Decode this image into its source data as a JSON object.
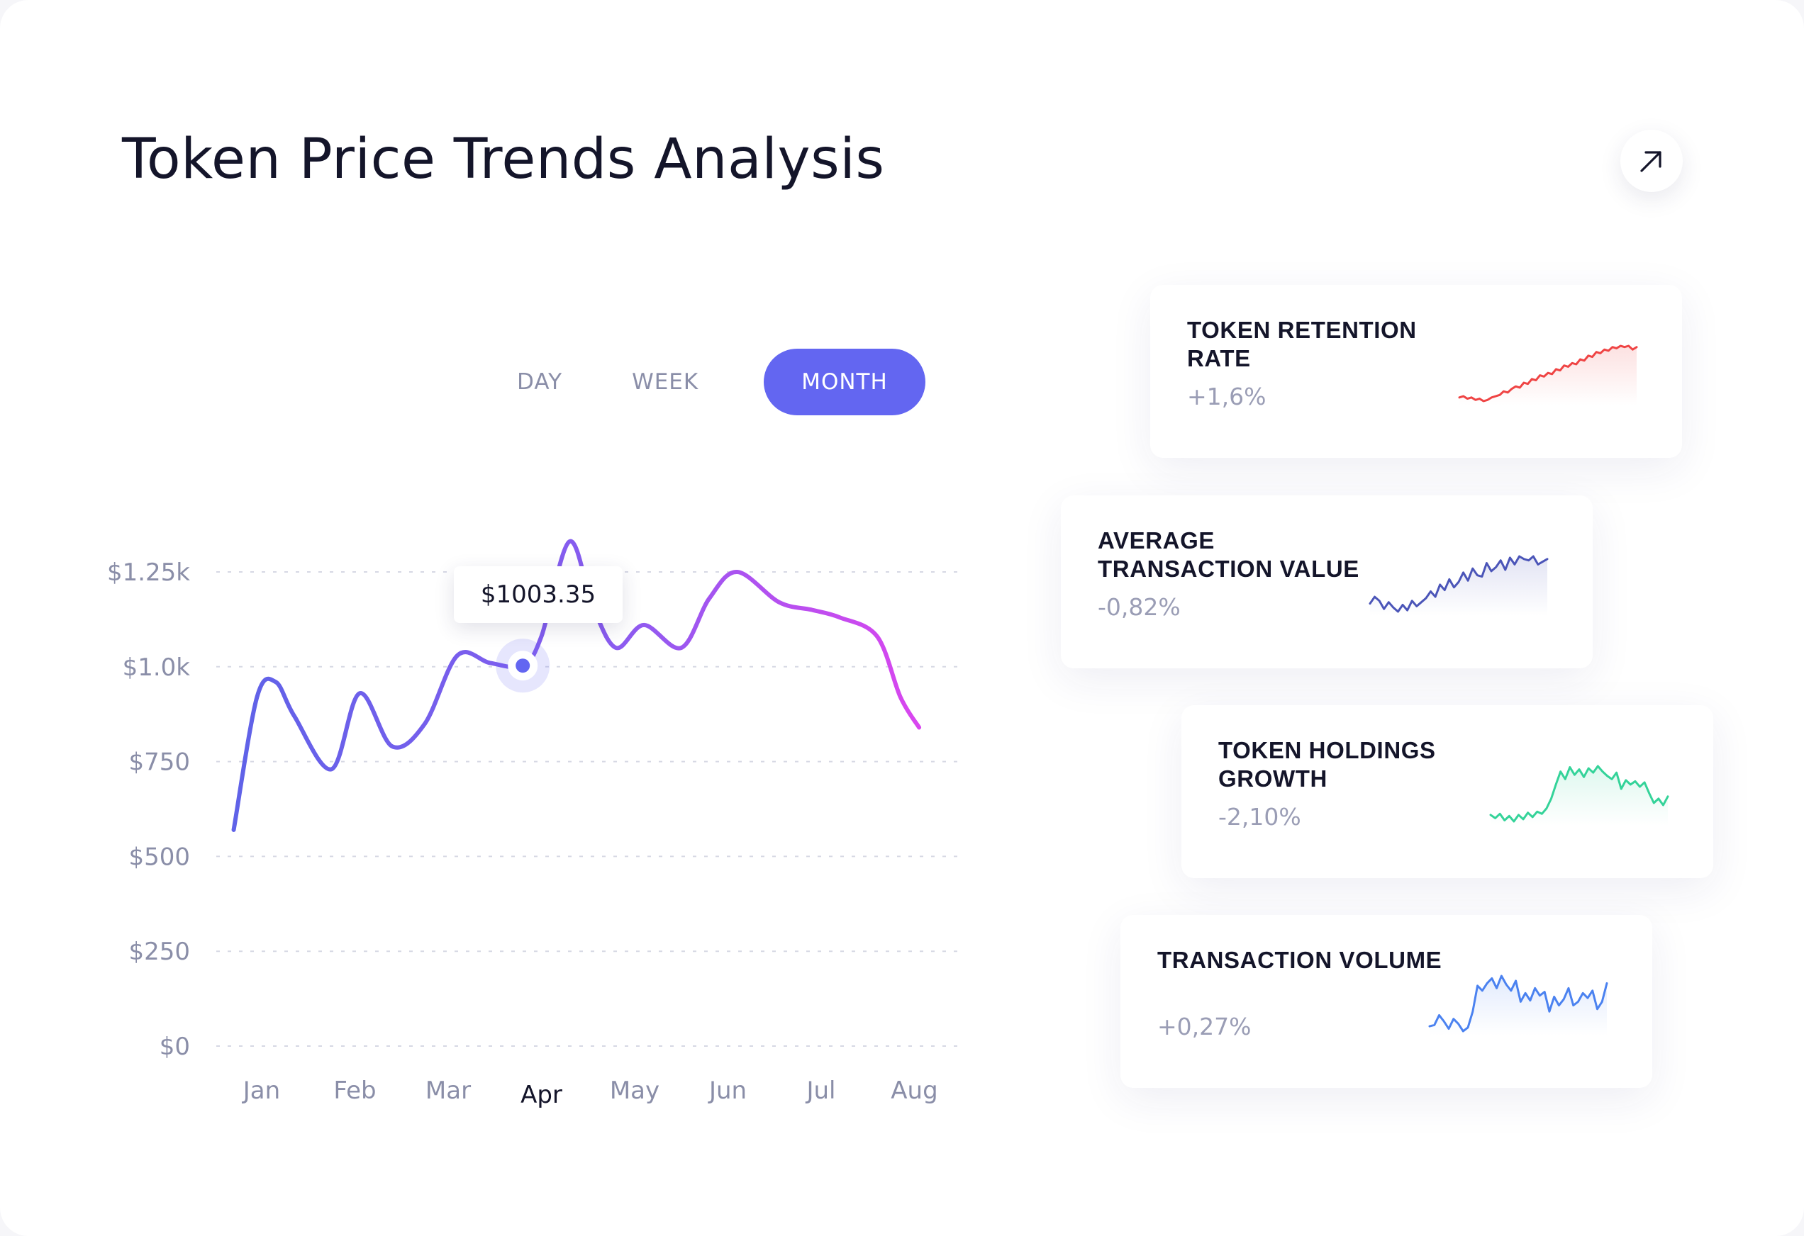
{
  "header": {
    "title": "Token Price Trends Analysis"
  },
  "range_toggle": {
    "options": [
      "DAY",
      "WEEK",
      "MONTH"
    ],
    "selected": "MONTH"
  },
  "tooltip": {
    "value": "$1003.35",
    "month": "Apr"
  },
  "colors": {
    "accent": "#6366f1",
    "line_start": "#5f62e8",
    "line_end": "#d946ef",
    "retention": "#ef4444",
    "avg_tx": "#4b55b8",
    "holdings": "#34d399",
    "volume": "#4b82f0"
  },
  "chart_data": {
    "type": "line",
    "title": "",
    "xlabel": "",
    "ylabel": "",
    "categories": [
      "Jan",
      "Feb",
      "Mar",
      "Apr",
      "May",
      "Jun",
      "Jul",
      "Aug"
    ],
    "highlighted_category": "Apr",
    "y_ticks": [
      "$0",
      "$250",
      "$500",
      "$750",
      "$1.0k",
      "$1.25k"
    ],
    "ylim": [
      0,
      1250
    ],
    "grid": true,
    "series": [
      {
        "x": [
          -0.3,
          -0.05,
          0.15,
          0.35,
          0.75,
          1.05,
          1.4,
          1.75,
          2.1,
          2.45,
          2.8,
          3.0,
          3.3,
          3.55,
          3.8,
          4.1,
          4.5,
          4.8,
          5.1,
          5.55,
          5.9,
          6.2,
          6.6,
          6.85,
          7.05
        ],
        "values": [
          570,
          920,
          960,
          870,
          730,
          930,
          790,
          850,
          1030,
          1010,
          1003,
          1080,
          1330,
          1160,
          1050,
          1110,
          1050,
          1180,
          1250,
          1170,
          1150,
          1130,
          1080,
          920,
          840
        ]
      }
    ]
  },
  "cards": [
    {
      "title": "TOKEN RETENTION RATE",
      "change": "+1,6%",
      "color_key": "retention",
      "spark": [
        8,
        9,
        7,
        8,
        6,
        7,
        5,
        6,
        8,
        9,
        10,
        13,
        12,
        15,
        17,
        16,
        20,
        19,
        23,
        22,
        26,
        25,
        28,
        27,
        31,
        30,
        34,
        33,
        36,
        35,
        39,
        38,
        42,
        41,
        45,
        44,
        47,
        46,
        49,
        48,
        50,
        49,
        50,
        47,
        49
      ]
    },
    {
      "title": "AVERAGE TRANSACTION VALUE",
      "change": "-0,82%",
      "color_key": "avg_tx",
      "spark": [
        15,
        20,
        17,
        11,
        16,
        12,
        9,
        14,
        10,
        17,
        13,
        16,
        19,
        24,
        20,
        29,
        25,
        33,
        27,
        31,
        38,
        32,
        41,
        36,
        35,
        45,
        39,
        42,
        47,
        40,
        49,
        44,
        50,
        48,
        47,
        50,
        44,
        46,
        48
      ]
    },
    {
      "title": "TOKEN HOLDINGS GROWTH",
      "change": "-2,10%",
      "color_key": "holdings",
      "spark": [
        8,
        5,
        9,
        3,
        7,
        2,
        8,
        4,
        10,
        6,
        11,
        9,
        14,
        23,
        36,
        48,
        41,
        52,
        45,
        50,
        43,
        51,
        47,
        53,
        48,
        44,
        41,
        47,
        32,
        40,
        36,
        39,
        34,
        38,
        28,
        19,
        23,
        17,
        25
      ]
    },
    {
      "title": "TRANSACTION VOLUME",
      "change": "+0,27%",
      "color_key": "volume",
      "spark": [
        10,
        11,
        19,
        14,
        8,
        16,
        12,
        6,
        9,
        22,
        43,
        39,
        45,
        49,
        41,
        51,
        44,
        39,
        47,
        30,
        37,
        31,
        41,
        35,
        38,
        22,
        34,
        27,
        32,
        41,
        27,
        30,
        37,
        33,
        39,
        24,
        30,
        45
      ]
    }
  ]
}
